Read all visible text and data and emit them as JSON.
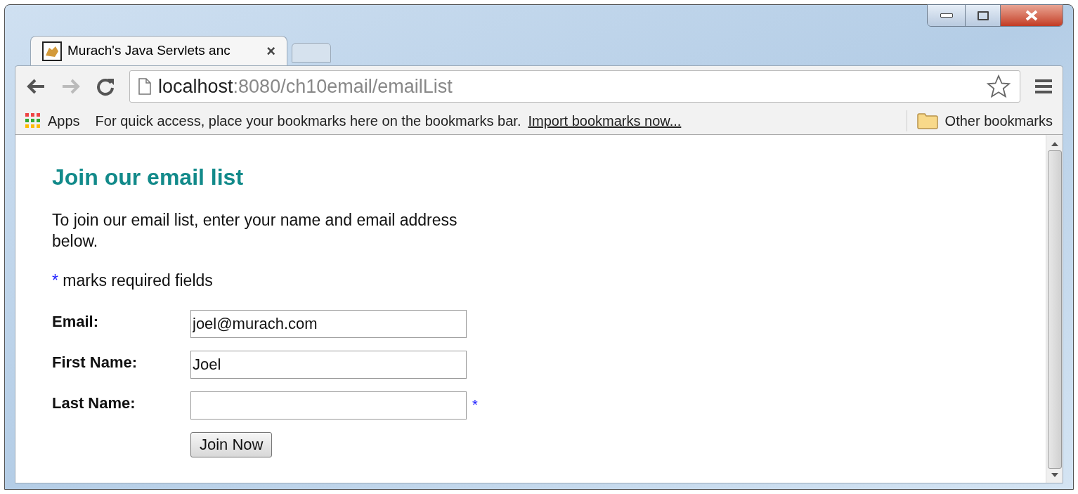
{
  "tabs": [
    {
      "title": "Murach's Java Servlets anc",
      "close": "×",
      "selected": true
    },
    {
      "kind": "new",
      "selected": false
    }
  ],
  "address_bar": {
    "host": "localhost",
    "path": ":8080/ch10email/emailList"
  },
  "bookmarks_bar": {
    "apps": "Apps",
    "hint": "For quick access, place your bookmarks here on the bookmarks bar.",
    "import_link": "Import bookmarks now...",
    "other": "Other bookmarks"
  },
  "page": {
    "heading": "Join our email list",
    "intro": "To join our email list, enter your name and email address below.",
    "note": {
      "mark": "*",
      "text": "marks required fields"
    },
    "fields": [
      {
        "label": "Email:",
        "value": "joel@murach.com"
      },
      {
        "label": "First Name:",
        "value": "Joel"
      },
      {
        "label": "Last Name:",
        "marker": "*"
      }
    ],
    "button": "Join Now"
  }
}
